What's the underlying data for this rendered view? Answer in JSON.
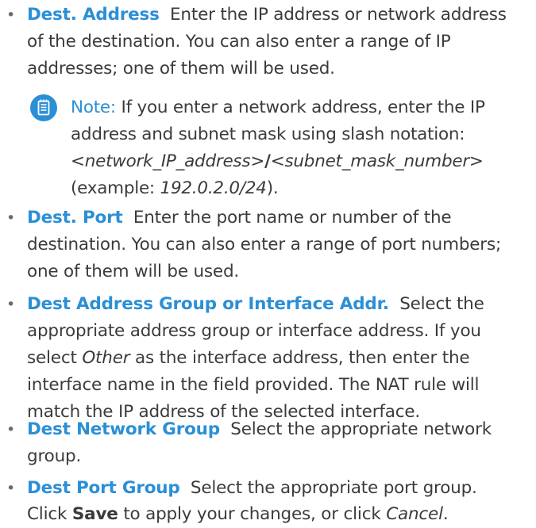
{
  "colors": {
    "accent": "#2b8fd6",
    "text": "#3b3b3b",
    "icon": "#2b8fd6"
  },
  "items": [
    {
      "term": "Dest. Address",
      "text": "Enter the IP address or network address of the destination. You can also enter a range of IP addresses; one of them will be used."
    },
    {
      "term": "Dest. Port",
      "text": "Enter the port name or number of the destination. You can also enter a range of port numbers; one of them will be used."
    },
    {
      "term": "Dest Address Group or Interface Addr.",
      "text_before": "Select the appropriate address group or interface address. If you select",
      "text_italic": "Other",
      "text_after": "as the interface address, then enter the interface name in the field provided. The NAT rule will match the IP address of the selected interface."
    },
    {
      "term": "Dest Network Group",
      "text": "Select the appropriate network group."
    },
    {
      "term": "Dest Port Group",
      "text": "Select the appropriate port group."
    }
  ],
  "note": {
    "icon": "note-icon",
    "label": "Note:",
    "text_before": "If you enter a network address, enter the IP address and subnet mask using slash notation:",
    "syntax_ip": "<network_IP_address>",
    "syntax_slash": "/",
    "syntax_mask": "<subnet_mask_number>",
    "example_prefix": "(example:",
    "example_value": "192.0.2.0/24",
    "example_suffix": ")."
  },
  "footer": {
    "prefix": "Click",
    "save": "Save",
    "middle": "to apply your changes, or click",
    "cancel": "Cancel",
    "suffix": "."
  }
}
